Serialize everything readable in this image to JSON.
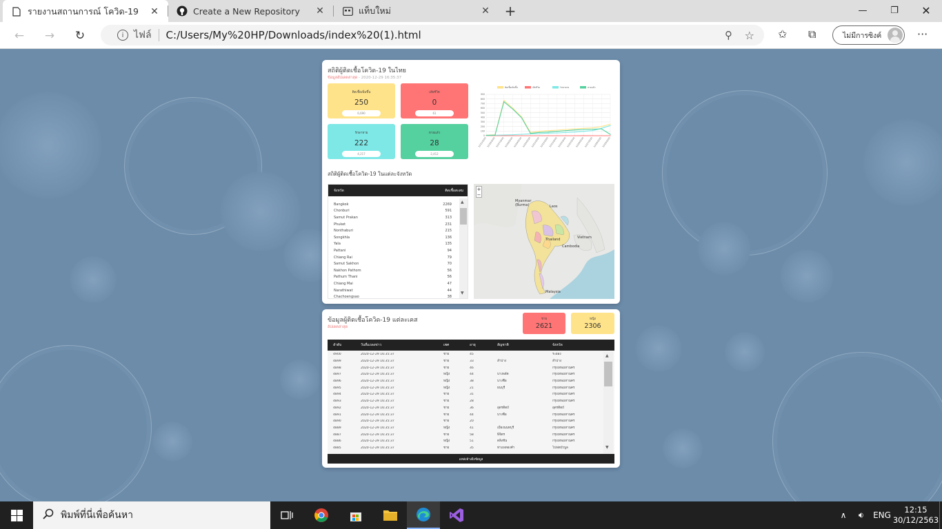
{
  "browser": {
    "tabs": [
      {
        "title": "รายงานสถานการณ์ โควิด-19",
        "active": true,
        "icon": "page-icon"
      },
      {
        "title": "Create a New Repository",
        "active": false,
        "icon": "github-icon"
      },
      {
        "title": "แท็บใหม่",
        "active": false,
        "icon": "newtab-icon"
      }
    ],
    "address_label": "ไฟล์",
    "url": "C:/Users/My%20HP/Downloads/index%20(1).html",
    "profile_label": "ไม่มีการซิงค์"
  },
  "dashboard": {
    "title": "สถิติผู้ติดเชื้อโควิด-19 ในไทย",
    "updated_label": "ข้อมูลอัปเดตล่าสุด",
    "updated_time": "- 2020-12-29 16:35:37",
    "stats": [
      {
        "label": "ติดเชื้อเพิ่มขึ้น",
        "value": "250",
        "pill": "6,690",
        "color": "#ffe38a"
      },
      {
        "label": "เสียชีวิต",
        "value": "0",
        "pill": "61",
        "color": "#ff7474"
      },
      {
        "label": "รักษาหาย",
        "value": "222",
        "pill": "4,217",
        "color": "#7de8e6"
      },
      {
        "label": "หายแล้ว",
        "value": "28",
        "pill": "2,412",
        "color": "#55d09f"
      }
    ],
    "chart_data": {
      "type": "line",
      "title": "",
      "legend_position": "top",
      "ylim": [
        0,
        900
      ],
      "yticks": [
        "900",
        "800",
        "700",
        "600",
        "500",
        "400",
        "300",
        "200",
        "100",
        "0"
      ],
      "x": [
        "12/15/2020",
        "12/16/2020",
        "12/17/2020",
        "12/18/2020",
        "12/19/2020",
        "12/20/2020",
        "12/21/2020",
        "12/22/2020",
        "12/23/2020",
        "12/24/2020",
        "12/25/2020",
        "12/26/2020",
        "12/27/2020",
        "12/28/2020",
        "12/29/2020"
      ],
      "series": [
        {
          "name": "ติดเชื้อเพิ่มขึ้น",
          "color": "#ffe38a",
          "values": [
            10,
            20,
            770,
            600,
            410,
            70,
            95,
            110,
            120,
            135,
            150,
            160,
            170,
            200,
            250
          ]
        },
        {
          "name": "เสียชีวิต",
          "color": "#ff7474",
          "values": [
            0,
            0,
            0,
            0,
            0,
            0,
            0,
            0,
            0,
            0,
            0,
            1,
            0,
            0,
            0
          ]
        },
        {
          "name": "รักษาหาย",
          "color": "#7de8e6",
          "values": [
            5,
            10,
            15,
            20,
            30,
            40,
            45,
            55,
            60,
            70,
            80,
            95,
            110,
            160,
            222
          ]
        },
        {
          "name": "หายแล้ว",
          "color": "#55d09f",
          "values": [
            8,
            12,
            740,
            580,
            390,
            50,
            70,
            80,
            95,
            110,
            125,
            135,
            140,
            150,
            28
          ]
        }
      ]
    },
    "province_title": "สถิติผู้ติดเชื้อโควิด-19 ในแต่ละจังหวัด",
    "province_headers": [
      "จังหวัด",
      "ติดเชื้อสะสม"
    ],
    "provinces": [
      [
        "Bangkok",
        "2269"
      ],
      [
        "Chonburi",
        "591"
      ],
      [
        "Samut Prakan",
        "313"
      ],
      [
        "Phuket",
        "231"
      ],
      [
        "Nonthaburi",
        "215"
      ],
      [
        "Songkhla",
        "136"
      ],
      [
        "Yala",
        "135"
      ],
      [
        "Pattani",
        "94"
      ],
      [
        "Chiang Rai",
        "79"
      ],
      [
        "Samut Sakhon",
        "70"
      ],
      [
        "Nakhon Pathom",
        "56"
      ],
      [
        "Pathum Thani",
        "56"
      ],
      [
        "Chiang Mai",
        "47"
      ],
      [
        "Narathiwat",
        "44"
      ],
      [
        "Chachoengsao",
        "38"
      ]
    ],
    "map": {
      "zoom_in": "+",
      "zoom_out": "−",
      "labels": [
        "Myanmar (Burma)",
        "Laos",
        "Thailand",
        "Vietnam",
        "Cambodia",
        "Malaysia"
      ]
    }
  },
  "cases": {
    "title": "ข้อมูลผู้ติดเชื้อโควิด-19 แต่ละเคส",
    "sub": "อัปเดตล่าสุด",
    "male_label": "ชาย",
    "male": "2621",
    "female_label": "หญิง",
    "female": "2306",
    "headers": [
      "ลำดับ",
      "วันที่แถลงข่าว",
      "เพศ",
      "อายุ",
      "สัญชาติ",
      "จังหวัด"
    ],
    "rows": [
      [
        "4900",
        "2020-12-29 16:35:37",
        "ชาย",
        "45",
        "",
        "ระยอง"
      ],
      [
        "4899",
        "2020-12-29 16:35:37",
        "ชาย",
        "33",
        "ลำปาง",
        "ลำปาง"
      ],
      [
        "4898",
        "2020-12-29 16:35:37",
        "ชาย",
        "46",
        "",
        "กรุงเทพมหานคร"
      ],
      [
        "4897",
        "2020-12-29 16:35:37",
        "หญิง",
        "44",
        "บางพลัด",
        "กรุงเทพมหานคร"
      ],
      [
        "4896",
        "2020-12-29 16:35:37",
        "หญิง",
        "38",
        "บางซื่อ",
        "กรุงเทพมหานคร"
      ],
      [
        "4895",
        "2020-12-29 16:35:37",
        "หญิง",
        "21",
        "ธนบุรี",
        "กรุงเทพมหานคร"
      ],
      [
        "4894",
        "2020-12-29 16:35:37",
        "ชาย",
        "31",
        "",
        "กรุงเทพมหานคร"
      ],
      [
        "4893",
        "2020-12-29 16:35:37",
        "ชาย",
        "28",
        "",
        "กรุงเทพมหานคร"
      ],
      [
        "4892",
        "2020-12-29 16:35:37",
        "ชาย",
        "36",
        "อุตรดิตถ์",
        "อุตรดิตถ์"
      ],
      [
        "4891",
        "2020-12-29 16:35:37",
        "ชาย",
        "44",
        "บางซื่อ",
        "กรุงเทพมหานคร"
      ],
      [
        "4890",
        "2020-12-29 16:35:37",
        "ชาย",
        "20",
        "",
        "กรุงเทพมหานคร"
      ],
      [
        "4889",
        "2020-12-29 16:35:37",
        "หญิง",
        "41",
        "เมืองนนทบุรี",
        "กรุงเทพมหานคร"
      ],
      [
        "4887",
        "2020-12-29 16:35:37",
        "ชาย",
        "58",
        "พิจิตร",
        "กรุงเทพมหานคร"
      ],
      [
        "4886",
        "2020-12-29 16:35:37",
        "หญิง",
        "51",
        "ตลิ่งชัน",
        "กรุงเทพมหานคร"
      ],
      [
        "4885",
        "2020-12-29 16:35:37",
        "ชาย",
        "35",
        "ท่าแพทองคำ",
        "โปฟดบัวบูล"
      ]
    ],
    "footer": "แหล่งอ้างอิงข้อมูล"
  },
  "taskbar": {
    "search_placeholder": "พิมพ์ที่นี่เพื่อค้นหา",
    "lang": "ENG",
    "time": "12:15",
    "date": "30/12/2563"
  }
}
